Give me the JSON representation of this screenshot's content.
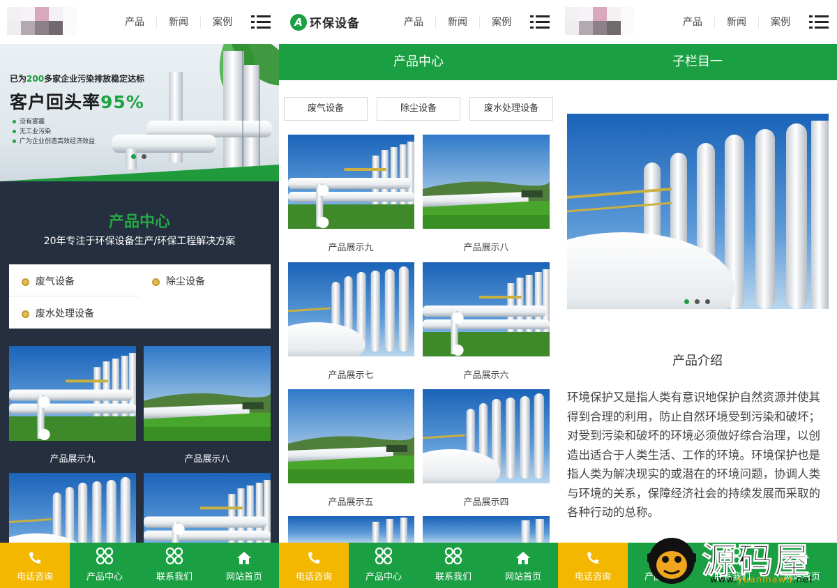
{
  "nav": {
    "products": "产品",
    "news": "新闻",
    "cases": "案例"
  },
  "brand": {
    "name": "环保设备",
    "badge": "A"
  },
  "banner": {
    "tag_prefix": "已为",
    "tag_num": "200",
    "tag_suffix": "多家企业污染排放稳定达标",
    "headline": "客户回头率",
    "headline_pct": "95%",
    "bullets": [
      "没有雾霾",
      "无工业污染",
      "广为企业创造高效经济效益"
    ]
  },
  "home_products": {
    "title": "产品中心",
    "subtitle": "20年专注于环保设备生产/环保工程解决方案",
    "categories": [
      "废气设备",
      "除尘设备",
      "废水处理设备"
    ],
    "items": [
      "产品展示九",
      "产品展示八"
    ]
  },
  "product_center": {
    "bar_title": "产品中心",
    "tabs": [
      "废气设备",
      "除尘设备",
      "废水处理设备"
    ],
    "items": [
      "产品展示九",
      "产品展示八",
      "产品展示七",
      "产品展示六",
      "产品展示五",
      "产品展示四"
    ]
  },
  "subpage": {
    "bar_title": "子栏目一",
    "intro_title": "产品介绍",
    "intro_text": "环境保护又是指人类有意识地保护自然资源并使其得到合理的利用，防止自然环境受到污染和破坏；对受到污染和破坏的环境必须做好综合治理，以创造出适合于人类生活、工作的环境。环境保护也是指人类为解决现实的或潜在的环境问题，协调人类与环境的关系，保障经济社会的持续发展而采取的各种行动的总称。"
  },
  "footer": {
    "call": "电话咨询",
    "products": "产品中心",
    "contact": "联系我们",
    "home": "网站首页"
  },
  "watermark": {
    "name": "源码屋",
    "url_a": "www.",
    "url_b": "yuanmawu",
    "url_c": ".net"
  },
  "colors": {
    "green": "#1aa043",
    "yellow": "#f3b700",
    "dark": "#262f3f"
  }
}
